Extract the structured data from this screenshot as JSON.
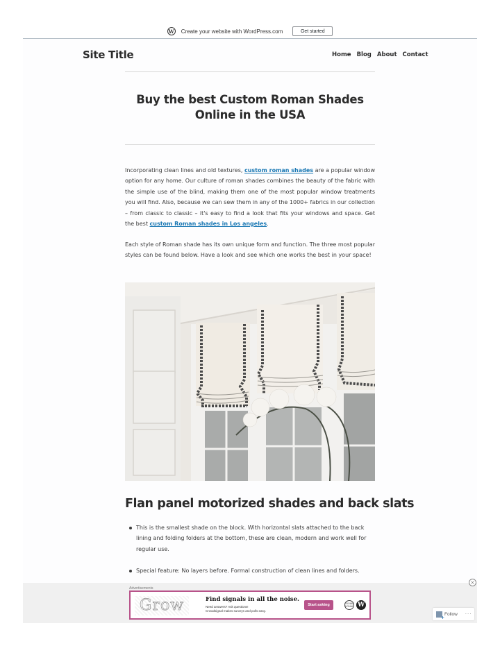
{
  "wpbar": {
    "logo_glyph": "W",
    "text": "Create your website with WordPress.com",
    "cta": "Get started"
  },
  "header": {
    "site_title": "Site Title",
    "nav": [
      "Home",
      "Blog",
      "About",
      "Contact"
    ]
  },
  "post": {
    "title": "Buy the best Custom Roman Shades Online in the USA",
    "p1_before": "Incorporating clean lines and old textures, ",
    "p1_link1": "custom roman shades",
    "p1_middle": " are a popular window option for any home. Our culture of roman shades combines the beauty of the fabric with the simple use of the blind, making them one of the most popular window treatments you will find. Also, because we can sew them in any of the 1000+ fabrics in our collection – from classic to classic – it's easy to find a look that fits your windows and space. Get the best ",
    "p1_link2": "custom Roman shades in Los angeles",
    "p1_after": ".",
    "p2": "Each style of Roman shade has its own unique form and function. The three most popular styles can be found below. Have a look and see which one works the best in your space!",
    "image_alt": "Roman shades with dark trim over windows, white orchid in foreground",
    "h2": "Flan panel motorized shades and back slats",
    "bullets": [
      "This is the smallest shade on the block. With horizontal slats attached to the back lining and folding folders at the bottom, these are clean, modern and work well for regular use.",
      "Special feature: No layers before. Formal construction of clean lines and folders."
    ]
  },
  "ad": {
    "label": "Advertisements",
    "brand_word": "Grow",
    "headline": "Find signals in all the noise.",
    "sub1": "Need answers? Ask questions!",
    "sub2": "Crowdsignal makes surveys and polls easy.",
    "button": "Start asking",
    "logo1": "CROWD SIGNAL",
    "logo2": "W",
    "accent": "#b8538a"
  },
  "widgets": {
    "close_glyph": "×",
    "follow": "Follow",
    "more": "···"
  }
}
